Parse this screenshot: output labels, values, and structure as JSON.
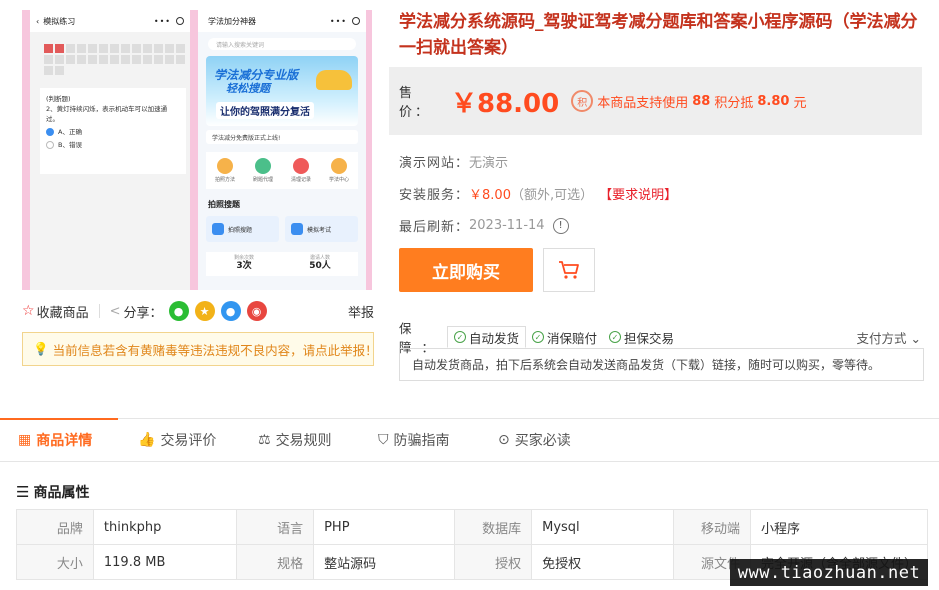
{
  "gallery": {
    "left_phone": {
      "title": "模拟练习",
      "question_type": "(判断题)",
      "question": "2、黄灯持续闪烁，表示机动车可以加速通过。",
      "options": [
        "A、正确",
        "B、错误"
      ]
    },
    "right_phone": {
      "title": "学法加分神器",
      "search_placeholder": "请输入搜索关键词",
      "banner_line1": "学法减分专业版",
      "banner_line2": "轻松搜题",
      "banner_line3": "让你的驾照满分复活",
      "notice": "学法减分免费版正式上线!",
      "icons": [
        "拍照方法",
        "刷题代理",
        "清理记录",
        "学法中心"
      ],
      "section": "拍照搜题",
      "buttons": [
        "拍照搜题",
        "模拟考试"
      ],
      "stats": [
        {
          "label": "剩余次数",
          "value": "3次"
        },
        {
          "label": "邀请人数",
          "value": "50人"
        }
      ]
    }
  },
  "share": {
    "favorite": "收藏商品",
    "share_label": "分享：",
    "report": "举报"
  },
  "warning": "当前信息若含有黄赌毒等违法违规不良内容，请点此举报！",
  "product": {
    "title": "学法减分系统源码_驾驶证驾考减分题库和答案小程序源码（学法减分一扫就出答案）",
    "price_label": "售 价：",
    "price": "￥88.00",
    "points_icon": "积",
    "points_prefix": "本商品支持使用",
    "points_value": "88",
    "points_mid": "积分抵",
    "points_amount": "8.80",
    "points_suffix": "元",
    "demo_label": "演示网站：",
    "demo_value": "无演示",
    "install_label": "安装服务：",
    "install_price": "￥8.00",
    "install_note": "（额外,可选）",
    "install_req": "【要求说明】",
    "refresh_label": "最后刷新：",
    "refresh_date": "2023-11-14",
    "buy_button": "立即购买",
    "guarantee_label": "保 障：",
    "guarantees": [
      "自动发货",
      "消保赔付",
      "担保交易"
    ],
    "pay_methods": "支付方式",
    "guarantee_desc": "自动发货商品，拍下后系统会自动发送商品发货（下载）链接，随时可以购买，零等待。"
  },
  "tabs": [
    "商品详情",
    "交易评价",
    "交易规则",
    "防骗指南",
    "买家必读"
  ],
  "attributes": {
    "heading": "商品属性",
    "rows": [
      [
        {
          "k": "品牌",
          "v": "thinkphp"
        },
        {
          "k": "语言",
          "v": "PHP"
        },
        {
          "k": "数据库",
          "v": "Mysql"
        },
        {
          "k": "移动端",
          "v": "小程序"
        }
      ],
      [
        {
          "k": "大小",
          "v": "119.8 MB"
        },
        {
          "k": "规格",
          "v": "整站源码"
        },
        {
          "k": "授权",
          "v": "免授权"
        },
        {
          "k": "源文件",
          "v": "完全开源（含全部源文件）"
        }
      ]
    ]
  },
  "watermark": "www.tiaozhuan.net",
  "colors": {
    "accent": "#ff4b1f",
    "buy": "#ff7d1f",
    "title": "#c4321d"
  }
}
